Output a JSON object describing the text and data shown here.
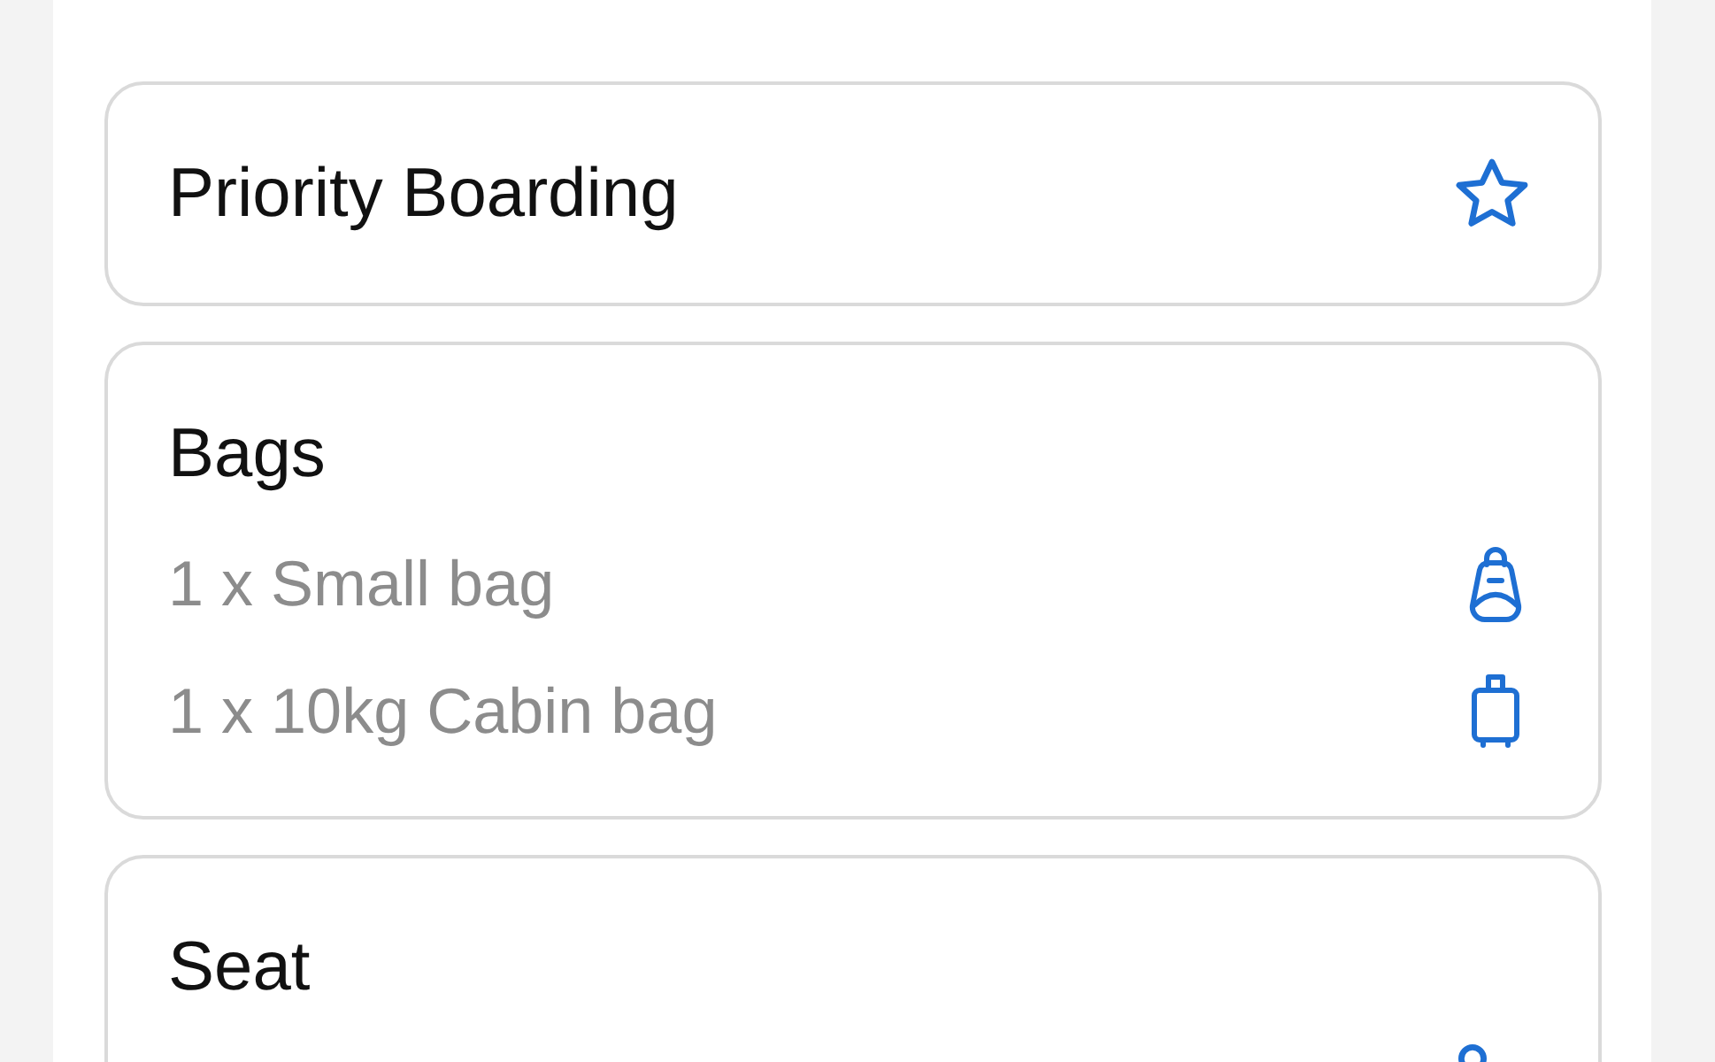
{
  "cards": [
    {
      "title": "Priority Boarding"
    },
    {
      "title": "Bags",
      "items": [
        "1 x Small bag",
        "1 x 10kg Cabin bag"
      ]
    },
    {
      "title": "Seat"
    }
  ]
}
